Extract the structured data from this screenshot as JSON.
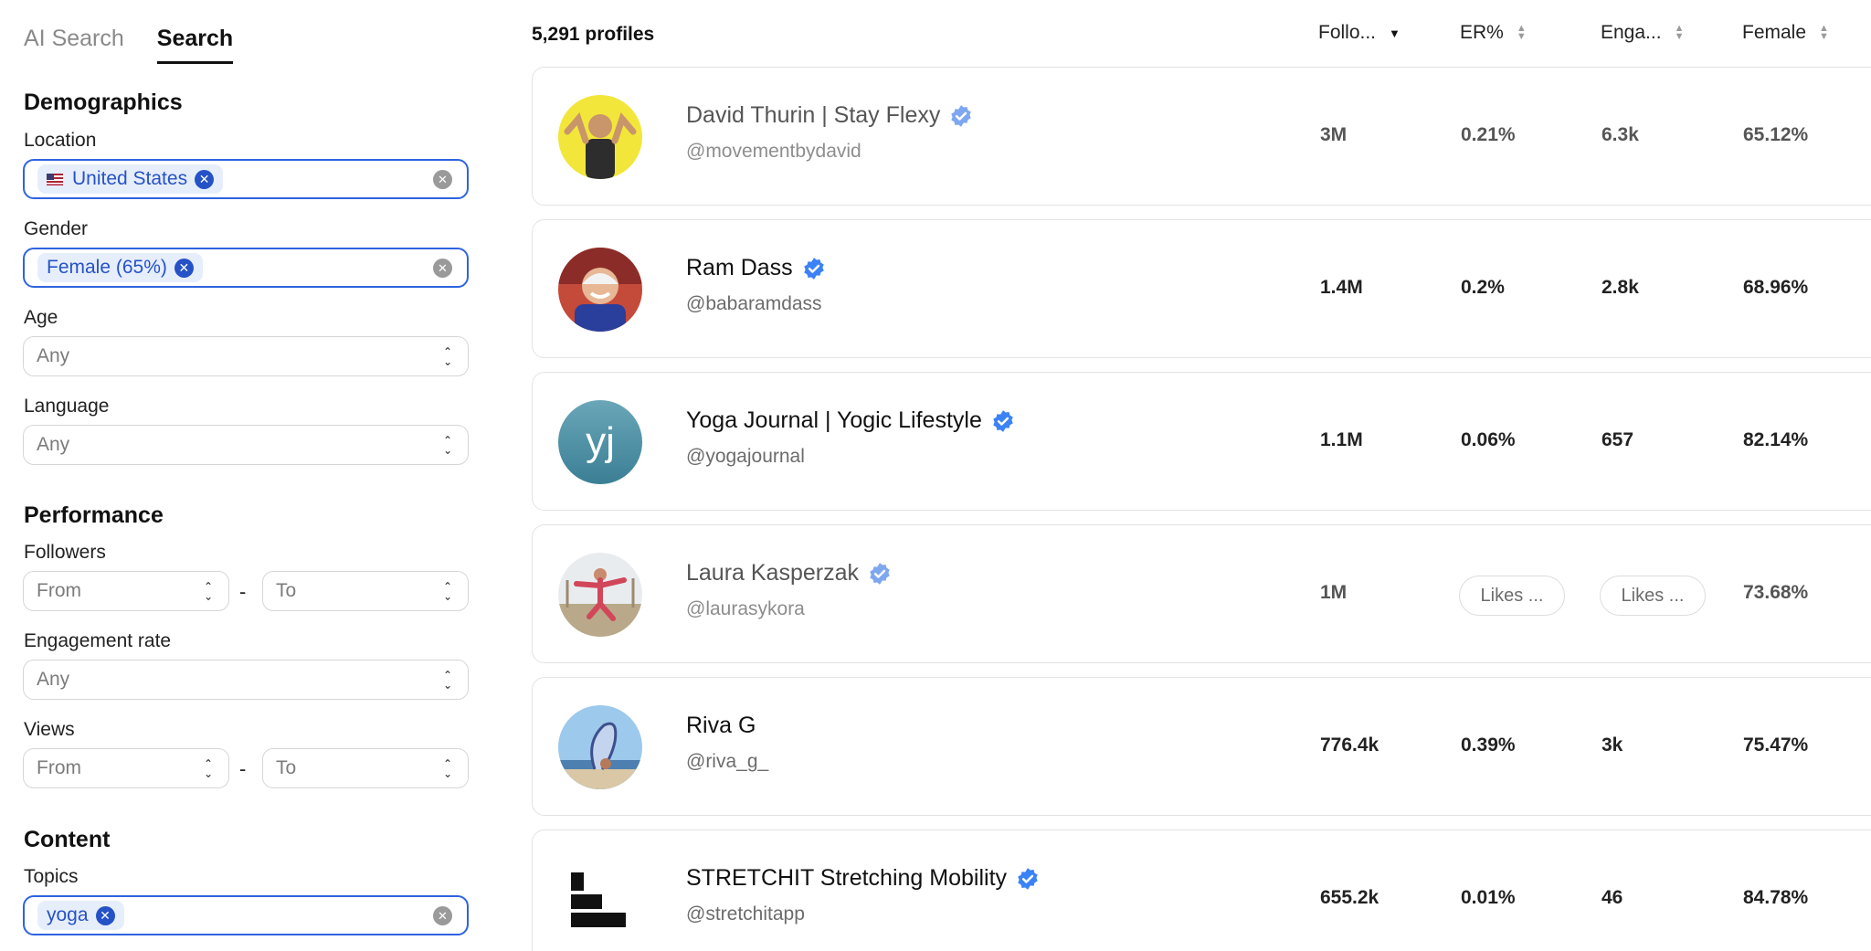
{
  "tabs": [
    {
      "label": "AI Search",
      "active": false
    },
    {
      "label": "Search",
      "active": true
    }
  ],
  "filters": {
    "demographics": {
      "title": "Demographics",
      "location": {
        "label": "Location",
        "chips": [
          "United States"
        ]
      },
      "gender": {
        "label": "Gender",
        "chips": [
          "Female (65%)"
        ]
      },
      "age": {
        "label": "Age",
        "placeholder": "Any"
      },
      "language": {
        "label": "Language",
        "placeholder": "Any"
      }
    },
    "performance": {
      "title": "Performance",
      "followers": {
        "label": "Followers",
        "from": "From",
        "to": "To"
      },
      "engagement_rate": {
        "label": "Engagement rate",
        "placeholder": "Any"
      },
      "views": {
        "label": "Views",
        "from": "From",
        "to": "To"
      },
      "range_separator": "-"
    },
    "content": {
      "title": "Content",
      "topics": {
        "label": "Topics",
        "chips": [
          "yoga"
        ]
      }
    }
  },
  "results": {
    "count_label": "5,291 profiles",
    "columns": [
      "Follo...",
      "ER%",
      "Enga...",
      "Female"
    ],
    "rows": [
      {
        "name": "David Thurin | Stay Flexy",
        "handle": "@movementbydavid",
        "verified": true,
        "dim": true,
        "followers": "3M",
        "er": "0.21%",
        "engagement": "6.3k",
        "female": "65.12%"
      },
      {
        "name": "Ram Dass",
        "handle": "@babaramdass",
        "verified": true,
        "dim": false,
        "followers": "1.4M",
        "er": "0.2%",
        "engagement": "2.8k",
        "female": "68.96%"
      },
      {
        "name": "Yoga Journal | Yogic Lifestyle",
        "handle": "@yogajournal",
        "verified": true,
        "dim": false,
        "followers": "1.1M",
        "er": "0.06%",
        "engagement": "657",
        "female": "82.14%"
      },
      {
        "name": "Laura Kasperzak",
        "handle": "@laurasykora",
        "verified": true,
        "dim": true,
        "followers": "1M",
        "er": "Likes ...",
        "engagement": "Likes ...",
        "female": "73.68%",
        "er_pill": true
      },
      {
        "name": "Riva G",
        "handle": "@riva_g_",
        "verified": false,
        "dim": false,
        "followers": "776.4k",
        "er": "0.39%",
        "engagement": "3k",
        "female": "75.47%"
      },
      {
        "name": "STRETCHIT Stretching Mobility",
        "handle": "@stretchitapp",
        "verified": true,
        "dim": false,
        "followers": "655.2k",
        "er": "0.01%",
        "engagement": "46",
        "female": "84.78%"
      }
    ],
    "avatars": {
      "yogajournal_initials": "yj"
    }
  },
  "colors": {
    "accent": "#2f63e0",
    "chip_bg": "#e7eefb",
    "chip_text": "#2552c6",
    "verified": "#3b82f6"
  }
}
